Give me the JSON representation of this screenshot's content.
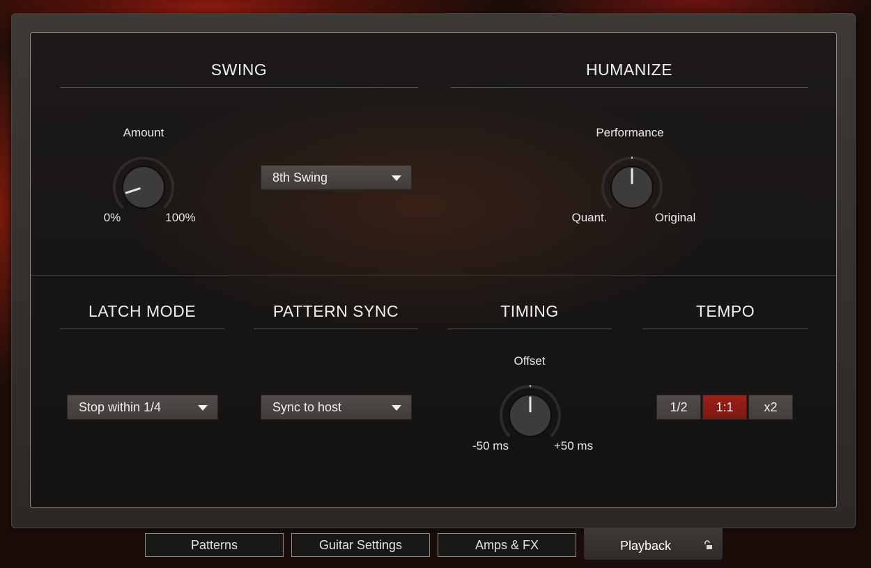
{
  "swing": {
    "title": "SWING",
    "amount_label": "Amount",
    "amount_min": "0%",
    "amount_max": "100%",
    "amount_value": 0.1,
    "mode_dropdown": "8th Swing"
  },
  "humanize": {
    "title": "HUMANIZE",
    "performance_label": "Performance",
    "performance_min": "Quant.",
    "performance_max": "Original",
    "performance_value": 0.5
  },
  "latch": {
    "title": "LATCH MODE",
    "dropdown": "Stop within 1/4"
  },
  "pattern_sync": {
    "title": "PATTERN SYNC",
    "dropdown": "Sync to host"
  },
  "timing": {
    "title": "TIMING",
    "offset_label": "Offset",
    "offset_min": "-50 ms",
    "offset_max": "+50 ms",
    "offset_value": 0.5
  },
  "tempo": {
    "title": "TEMPO",
    "options": [
      "1/2",
      "1:1",
      "x2"
    ],
    "selected": "1:1"
  },
  "tabs": {
    "patterns": "Patterns",
    "guitar_settings": "Guitar Settings",
    "amps_fx": "Amps & FX",
    "playback": "Playback"
  },
  "colors": {
    "accent": "#8e1c15",
    "panel_bg": "#171514",
    "knob": "#3c3a39"
  }
}
